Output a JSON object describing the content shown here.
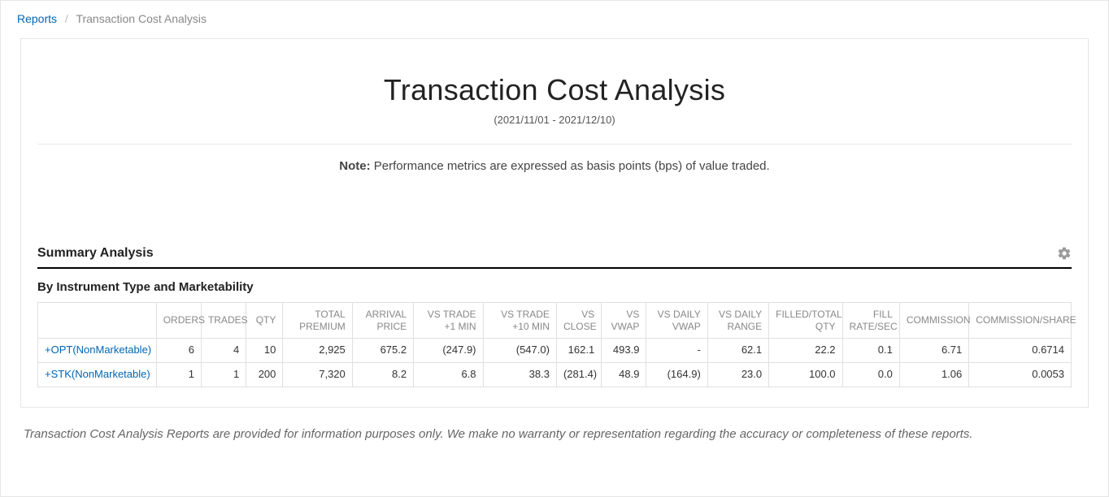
{
  "breadcrumb": {
    "root": "Reports",
    "current": "Transaction Cost Analysis"
  },
  "page": {
    "title": "Transaction Cost Analysis",
    "date_range": "(2021/11/01 - 2021/12/10)",
    "note_label": "Note:",
    "note_text": "Performance metrics are expressed as basis points (bps) of value traded."
  },
  "section": {
    "heading": "Summary Analysis",
    "subheading": "By Instrument Type and Marketability"
  },
  "table": {
    "headers": [
      "",
      "ORDERS",
      "TRADES",
      "QTY",
      "TOTAL PREMIUM",
      "ARRIVAL PRICE",
      "VS TRADE +1 MIN",
      "VS TRADE +10 MIN",
      "VS CLOSE",
      "VS VWAP",
      "VS DAILY VWAP",
      "VS DAILY RANGE",
      "FILLED/TOTAL QTY",
      "FILL RATE/SEC",
      "COMMISSION",
      "COMMISSION/SHARE"
    ],
    "rows": [
      {
        "label_plus": "+",
        "label": "OPT(NonMarketable)",
        "cells": [
          "6",
          "4",
          "10",
          "2,925",
          "675.2",
          "(247.9)",
          "(547.0)",
          "162.1",
          "493.9",
          "-",
          "62.1",
          "22.2",
          "0.1",
          "6.71",
          "0.6714"
        ]
      },
      {
        "label_plus": "+",
        "label": "STK(NonMarketable)",
        "cells": [
          "1",
          "1",
          "200",
          "7,320",
          "8.2",
          "6.8",
          "38.3",
          "(281.4)",
          "48.9",
          "(164.9)",
          "23.0",
          "100.0",
          "0.0",
          "1.06",
          "0.0053"
        ]
      }
    ]
  },
  "disclaimer": "Transaction Cost Analysis Reports are provided for information purposes only. We make no warranty or representation regarding the accuracy or completeness of these reports."
}
